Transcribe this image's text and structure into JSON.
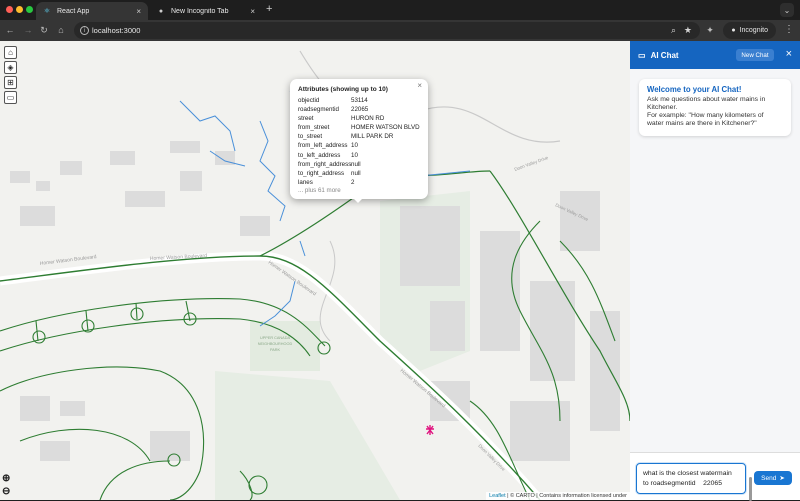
{
  "browser": {
    "tabs": [
      {
        "label": "React App",
        "close": "×"
      },
      {
        "label": "New Incognito Tab",
        "close": "×"
      }
    ],
    "new_tab": "+",
    "url": "localhost:3000",
    "mode_label": "Incognito"
  },
  "map": {
    "road_labels": [
      "Homer Watson Boulevard",
      "Homer Watson Boulevard",
      "Homer Watson Boulevard",
      "Homer Watson Boulevard",
      "Doon Valley Drive",
      "Doon Valley Drive",
      "Doon Valley Drive"
    ],
    "park_label": [
      "UPPER CANADA",
      "NEIGHBOURHOOD",
      "PARK"
    ],
    "zoom_in": "+",
    "zoom_out": "−",
    "attribution": {
      "leaflet": "Leaflet",
      "carto": "CARTO",
      "text": "| © CARTO | Contains information licensed under"
    }
  },
  "popup": {
    "title": "Attributes (showing up to 10)",
    "close": "×",
    "rows": [
      {
        "key": "objectid",
        "value": "53114"
      },
      {
        "key": "roadsegmentid",
        "value": "22065"
      },
      {
        "key": "street",
        "value": "HURON RD"
      },
      {
        "key": "from_street",
        "value": "HOMER WATSON BLVD"
      },
      {
        "key": "to_street",
        "value": "MILL PARK DR"
      },
      {
        "key": "from_left_address",
        "value": "10"
      },
      {
        "key": "to_left_address",
        "value": "10"
      },
      {
        "key": "from_right_address",
        "value": "null"
      },
      {
        "key": "to_right_address",
        "value": "null"
      },
      {
        "key": "lanes",
        "value": "2"
      }
    ],
    "more": "... plus 61 more"
  },
  "chat": {
    "title": "AI Chat",
    "new_chat": "New Chat",
    "close": "×",
    "welcome_title": "Welcome to your AI Chat!",
    "welcome_lines": [
      "Ask me questions about water mains in",
      "Kitchener.",
      "For example: \"How many kilometers of",
      "water mains are there in Kitchener?\""
    ],
    "input_value": [
      "what is the closest watermain",
      "to roadsegmentid    22065"
    ],
    "send": "Send"
  },
  "colors": {
    "accent": "#1565c0",
    "road": "#2e7d32",
    "watermain": "#4a90d9"
  }
}
